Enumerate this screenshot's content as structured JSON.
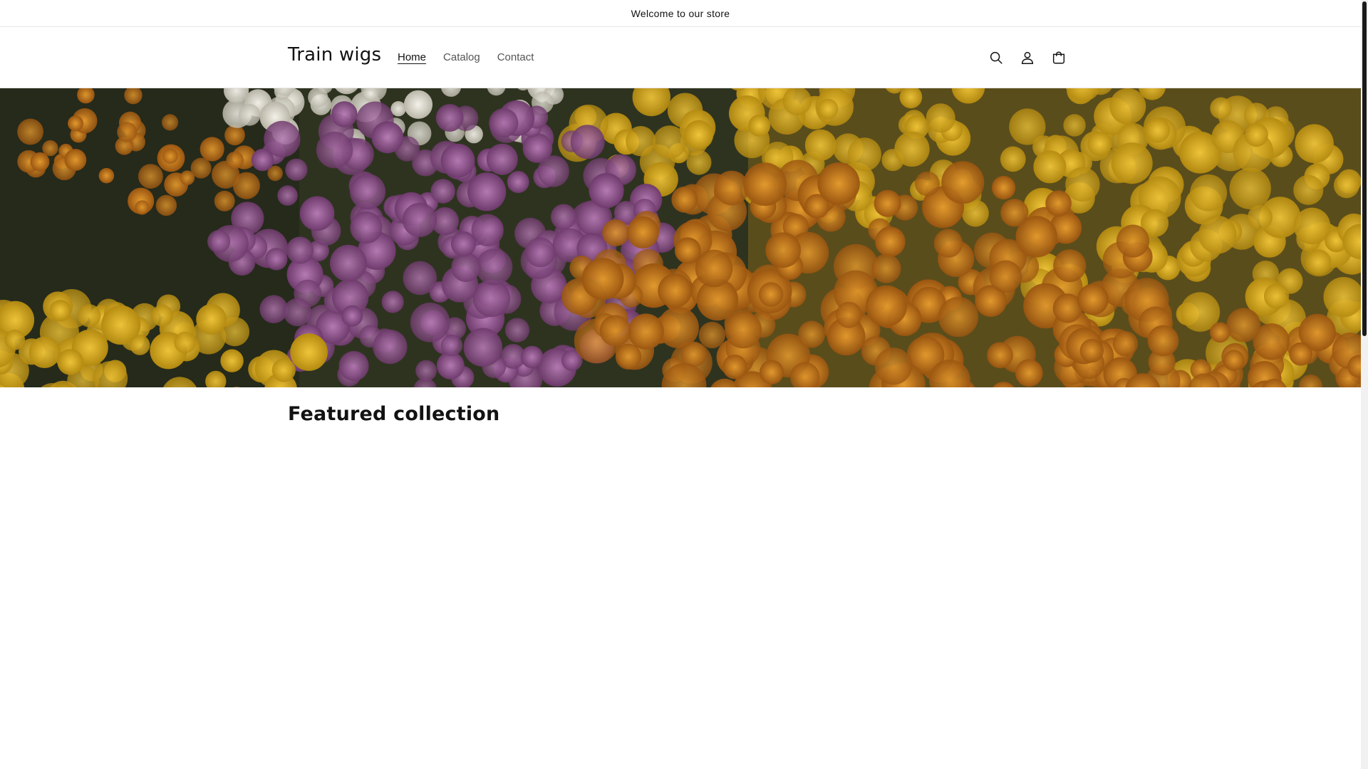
{
  "announcement": {
    "text": "Welcome to our store"
  },
  "header": {
    "logo": "Train wigs",
    "nav": [
      {
        "label": "Home",
        "active": true
      },
      {
        "label": "Catalog",
        "active": false
      },
      {
        "label": "Contact",
        "active": false
      }
    ],
    "icons": [
      "search-icon",
      "account-icon",
      "cart-icon"
    ]
  },
  "hero": {
    "image": "flowers-banner",
    "colors": {
      "purple": "#8d4c8c",
      "orange": "#c9761a",
      "yellow": "#d9ae1c",
      "white": "#e9e6dc",
      "foliage": "#2e3320"
    }
  },
  "featured": {
    "title": "Featured collection"
  },
  "colors": {
    "text": "#121212",
    "nav_muted": "#555555",
    "border": "#e6e6e6"
  }
}
